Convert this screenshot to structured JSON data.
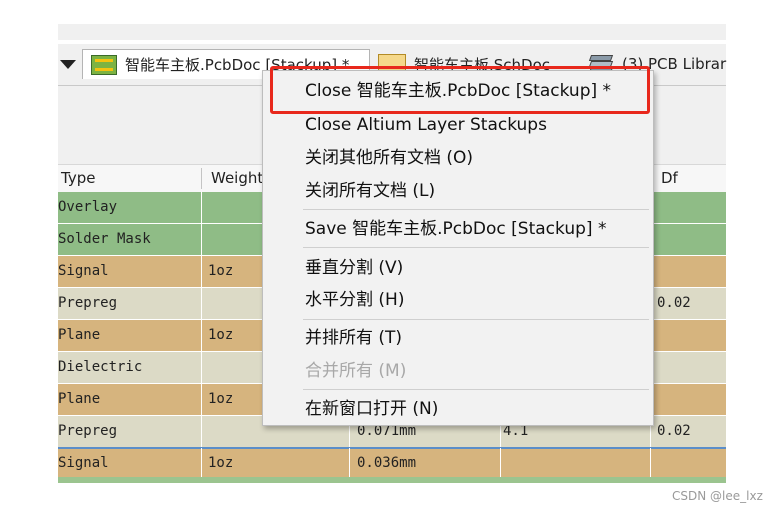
{
  "tabs": [
    {
      "label": "智能车主板.PcbDoc [Stackup] *",
      "icon": "pcb-icon"
    },
    {
      "label": "智能车主板.SchDoc",
      "icon": "schematic-icon"
    },
    {
      "label": "(3) PCB Librar",
      "icon": "library-icon"
    }
  ],
  "grid": {
    "headers": [
      "Type",
      "Weight",
      "Df"
    ],
    "rows": [
      {
        "type": "Overlay",
        "weight": "",
        "thickness": "",
        "dk": "",
        "df": "",
        "color": "#8fbc86"
      },
      {
        "type": "Solder Mask",
        "weight": "",
        "thickness": "",
        "dk": "",
        "df": "",
        "color": "#8fbc86"
      },
      {
        "type": "Signal",
        "weight": "1oz",
        "thickness": "",
        "dk": "",
        "df": "",
        "color": "#d6b47e"
      },
      {
        "type": "Prepreg",
        "weight": "",
        "thickness": "",
        "dk": "",
        "df": "0.02",
        "color": "#dcdac6"
      },
      {
        "type": "Plane",
        "weight": "1oz",
        "thickness": "",
        "dk": "",
        "df": "",
        "color": "#d6b47e"
      },
      {
        "type": "Dielectric",
        "weight": "",
        "thickness": "",
        "dk": "",
        "df": "",
        "color": "#dcdac6"
      },
      {
        "type": "Plane",
        "weight": "1oz",
        "thickness": "",
        "dk": "",
        "df": "",
        "color": "#d6b47e"
      },
      {
        "type": "Prepreg",
        "weight": "",
        "thickness": "0.071mm",
        "dk": "4.1",
        "df": "0.02",
        "color": "#dcdac6"
      },
      {
        "type": "Signal",
        "weight": "1oz",
        "thickness": "0.036mm",
        "dk": "",
        "df": "",
        "color": "#d6b47e",
        "selected": true
      }
    ]
  },
  "context_menu": {
    "items": [
      {
        "label": "Close 智能车主板.PcbDoc [Stackup] *",
        "enabled": true
      },
      {
        "label": "Close Altium Layer Stackups",
        "enabled": true
      },
      {
        "label": "关闭其他所有文档 (O)",
        "enabled": true
      },
      {
        "label": "关闭所有文档 (L)",
        "enabled": true
      },
      {
        "label": "Save 智能车主板.PcbDoc [Stackup] *",
        "enabled": true
      },
      {
        "label": "垂直分割 (V)",
        "enabled": true
      },
      {
        "label": "水平分割 (H)",
        "enabled": true
      },
      {
        "label": "并排所有 (T)",
        "enabled": true
      },
      {
        "label": "合并所有 (M)",
        "enabled": false
      },
      {
        "label": "在新窗口打开 (N)",
        "enabled": true
      }
    ],
    "highlight_color": "#e8281c"
  },
  "watermark": "CSDN @lee_lxz"
}
